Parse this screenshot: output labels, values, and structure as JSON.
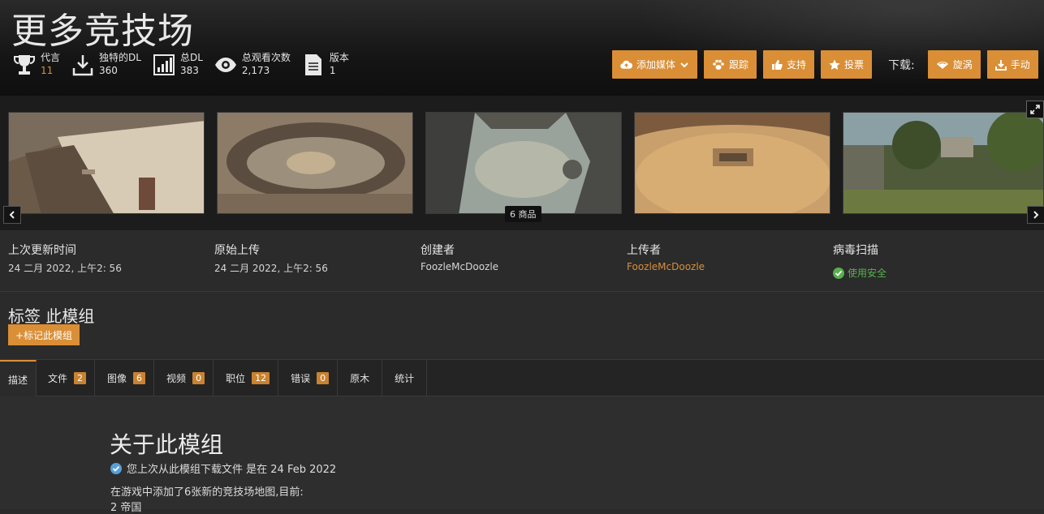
{
  "title": "更多竞技场",
  "stats": [
    {
      "label": "代言",
      "value": "11",
      "icon": "trophy-icon"
    },
    {
      "label": "独特的DL",
      "value": "360",
      "icon": "download-icon"
    },
    {
      "label": "总DL",
      "value": "383",
      "icon": "bar-chart-icon"
    },
    {
      "label": "总观看次数",
      "value": "2,173",
      "icon": "eye-icon"
    },
    {
      "label": "版本",
      "value": "1",
      "icon": "document-icon"
    }
  ],
  "actions": {
    "add_media": "添加媒体",
    "track": "跟踪",
    "endorse": "支持",
    "vote": "投票",
    "download_label": "下载:",
    "vortex": "旋涡",
    "manual": "手动"
  },
  "gallery": {
    "count_label": "6 商品"
  },
  "meta": {
    "last_updated_label": "上次更新时间",
    "last_updated_value": "24 二月 2022, 上午2: 56",
    "original_upload_label": "原始上传",
    "original_upload_value": "24 二月 2022, 上午2: 56",
    "creator_label": "创建者",
    "creator_value": "FoozleMcDoozle",
    "uploader_label": "上传者",
    "uploader_value": "FoozleMcDoozle",
    "virus_scan_label": "病毒扫描",
    "virus_scan_value": "使用安全"
  },
  "tags": {
    "heading": "标签 此模组",
    "button": "+标记此模组"
  },
  "tabs": [
    {
      "label": "描述"
    },
    {
      "label": "文件",
      "badge": "2"
    },
    {
      "label": "图像",
      "badge": "6"
    },
    {
      "label": "视频",
      "badge": "0"
    },
    {
      "label": "职位",
      "badge": "12"
    },
    {
      "label": "错误",
      "badge": "0"
    },
    {
      "label": "原木"
    },
    {
      "label": "统计"
    }
  ],
  "content": {
    "heading": "关于此模组",
    "download_note": "您上次从此模组下载文件 是在 24 Feb 2022",
    "p1": "在游戏中添加了6张新的竞技场地图,目前:",
    "p2": "2 帝国"
  },
  "colors": {
    "accent": "#da8e35",
    "safe": "#58b04f"
  }
}
